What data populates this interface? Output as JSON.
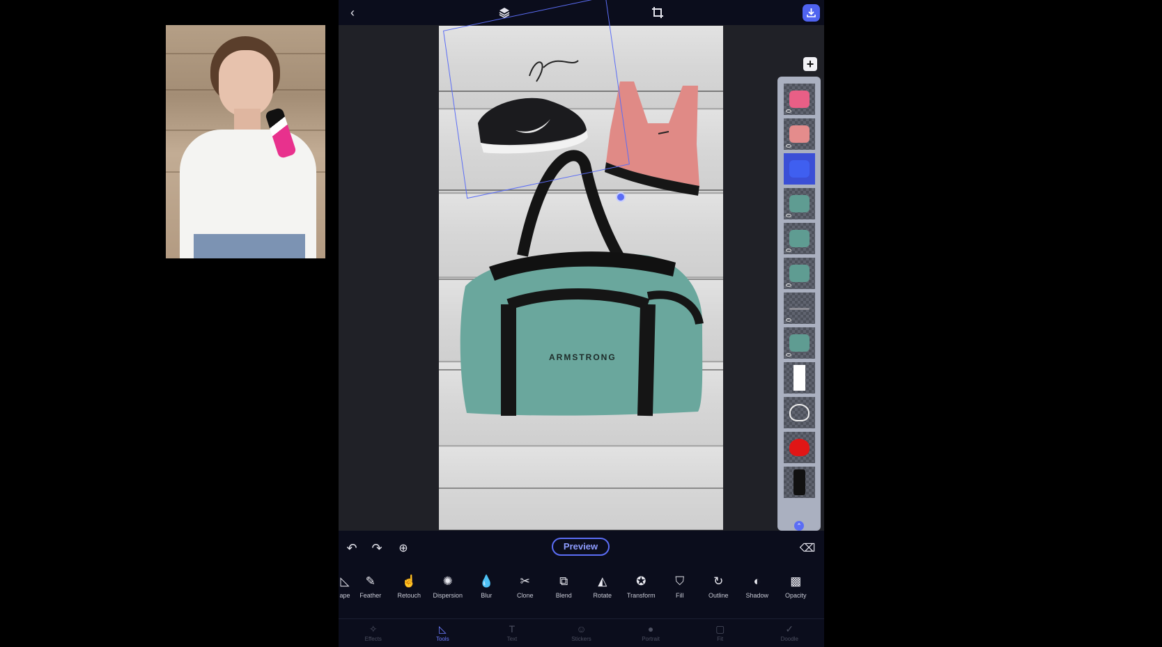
{
  "webcam": {
    "label": "presenter video"
  },
  "topbar": {
    "back_icon": "chevron-left-icon",
    "layers_icon": "layers-icon",
    "crop_icon": "crop-icon",
    "save_icon": "download-icon"
  },
  "canvas": {
    "bag_text": "ARMSTRONG"
  },
  "layers_panel": {
    "add_label": "+",
    "selected_index": 2,
    "thumbnails": [
      {
        "name": "headphones",
        "color": "#e85f86"
      },
      {
        "name": "sports-bra",
        "color": "#e48c8c"
      },
      {
        "name": "sneaker",
        "color": "#3f5ff0"
      },
      {
        "name": "bag-part",
        "color": "#5f9c92"
      },
      {
        "name": "bag-part",
        "color": "#5f9c92"
      },
      {
        "name": "bag-part",
        "color": "#5f9c92"
      },
      {
        "name": "strap",
        "color": "#8d8d95"
      },
      {
        "name": "bag-small",
        "color": "#5f9c92"
      },
      {
        "name": "white-shape",
        "color": "#ffffff"
      },
      {
        "name": "heart-outline",
        "color": "#eeeeee"
      },
      {
        "name": "heart-red",
        "color": "#e01616"
      },
      {
        "name": "phone",
        "color": "#111111"
      }
    ],
    "expand_icon": "chevron-up-icon"
  },
  "toolbar": {
    "undo_icon": "undo-icon",
    "redo_icon": "redo-icon",
    "zoom_icon": "zoom-in-icon",
    "preview_label": "Preview",
    "eraser_icon": "eraser-icon"
  },
  "tools": [
    {
      "label": "ape",
      "icon": "shape-icon",
      "glyph": "◺"
    },
    {
      "label": "Feather",
      "icon": "feather-icon",
      "glyph": "✎"
    },
    {
      "label": "Retouch",
      "icon": "retouch-icon",
      "glyph": "☝"
    },
    {
      "label": "Dispersion",
      "icon": "dispersion-icon",
      "glyph": "✺"
    },
    {
      "label": "Blur",
      "icon": "blur-icon",
      "glyph": "💧"
    },
    {
      "label": "Clone",
      "icon": "clone-icon",
      "glyph": "✂"
    },
    {
      "label": "Blend",
      "icon": "blend-icon",
      "glyph": "⧉"
    },
    {
      "label": "Rotate",
      "icon": "rotate-icon",
      "glyph": "◭"
    },
    {
      "label": "Transform",
      "icon": "transform-icon",
      "glyph": "✪"
    },
    {
      "label": "Fill",
      "icon": "fill-icon",
      "glyph": "⛉"
    },
    {
      "label": "Outline",
      "icon": "outline-icon",
      "glyph": "↻"
    },
    {
      "label": "Shadow",
      "icon": "shadow-icon",
      "glyph": "◐"
    },
    {
      "label": "Opacity",
      "icon": "opacity-icon",
      "glyph": "▩"
    }
  ],
  "bottomnav": [
    {
      "label": "Effects",
      "icon": "effects-icon",
      "glyph": "✧"
    },
    {
      "label": "Tools",
      "icon": "tools-icon",
      "glyph": "◺"
    },
    {
      "label": "Text",
      "icon": "text-icon",
      "glyph": "T"
    },
    {
      "label": "Stickers",
      "icon": "stickers-icon",
      "glyph": "☺"
    },
    {
      "label": "Portrait",
      "icon": "portrait-icon",
      "glyph": "●"
    },
    {
      "label": "Fit",
      "icon": "fit-icon",
      "glyph": "▢"
    },
    {
      "label": "Doodle",
      "icon": "doodle-icon",
      "glyph": "✓"
    }
  ],
  "active_nav": "Tools",
  "colors": {
    "accent": "#5b6df5",
    "toolbar_bg": "#0b0d1c"
  }
}
